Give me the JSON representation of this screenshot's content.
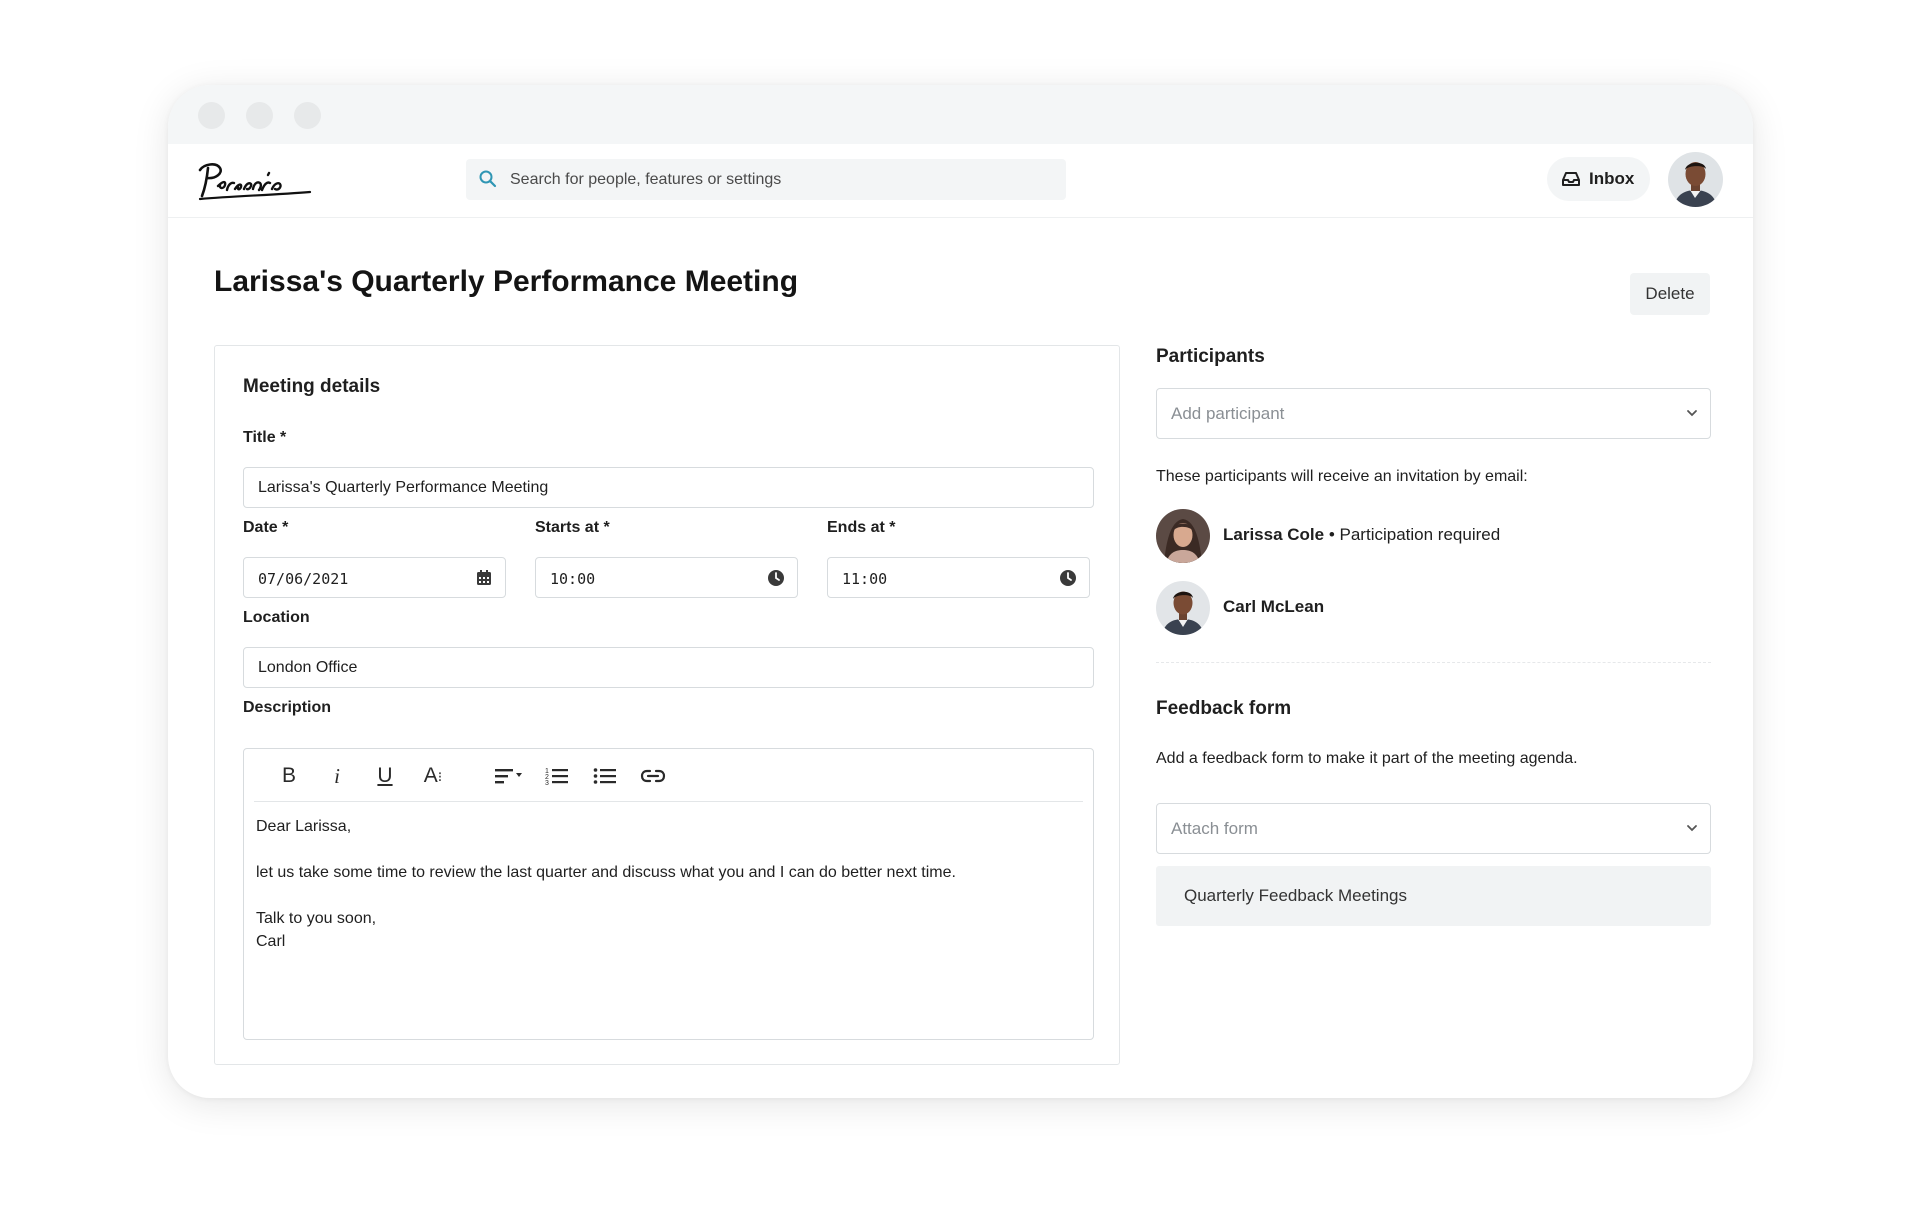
{
  "header": {
    "logo_text": "Personio",
    "search_placeholder": "Search for people, features or settings",
    "inbox_label": "Inbox"
  },
  "page": {
    "title": "Larissa's Quarterly Performance Meeting",
    "delete_label": "Delete"
  },
  "meeting_details": {
    "heading": "Meeting details",
    "title_label": "Title *",
    "title_value": "Larissa's Quarterly Performance Meeting",
    "date_label": "Date *",
    "date_value": "07/06/2021",
    "starts_label": "Starts at *",
    "starts_value": "10:00",
    "ends_label": "Ends at *",
    "ends_value": "11:00",
    "location_label": "Location",
    "location_value": "London Office",
    "description_label": "Description",
    "toolbar": [
      "B",
      "i",
      "U",
      "A"
    ],
    "description_lines": {
      "greeting": "Dear Larissa,",
      "body": "let us take some time to review the last quarter and discuss what you and I can do better next time.",
      "closing": "Talk to you soon,",
      "signature": "Carl"
    }
  },
  "participants": {
    "heading": "Participants",
    "add_placeholder": "Add participant",
    "invitation_note": "These participants will receive an invitation by email:",
    "list": [
      {
        "name": "Larissa Cole",
        "note": "• Participation required"
      },
      {
        "name": "Carl McLean",
        "note": ""
      }
    ]
  },
  "feedback_form": {
    "heading": "Feedback form",
    "description": "Add a feedback form to make it part of the meeting agenda.",
    "attach_placeholder": "Attach form",
    "option": "Quarterly Feedback Meetings"
  },
  "icons": [
    "search-icon",
    "inbox-icon",
    "calendar-icon",
    "clock-icon",
    "chevron-down-icon",
    "bold-icon",
    "italic-icon",
    "underline-icon",
    "font-size-icon",
    "align-icon",
    "ordered-list-icon",
    "bullet-list-icon",
    "link-icon"
  ],
  "colors": {
    "accent": "#2f96b4",
    "text": "#1f1f1f",
    "muted": "#8a8f94",
    "border": "#d7dbde"
  }
}
